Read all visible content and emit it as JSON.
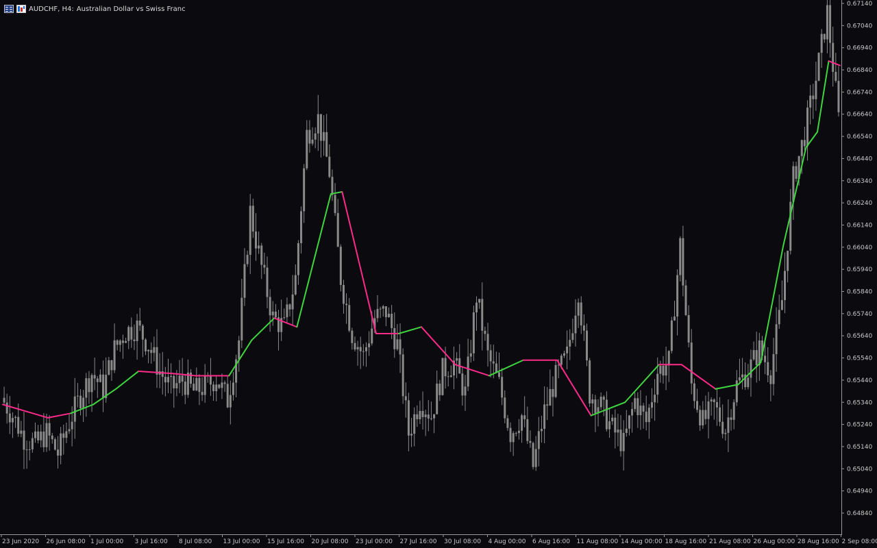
{
  "header": {
    "symbol_timeframe": "AUDCHF, H4:",
    "description": "Australian Dollar vs Swiss  Franc"
  },
  "colors": {
    "background": "#0b0b0f",
    "candle": "#8a8a8a",
    "trend_up": "#3fd63f",
    "trend_down": "#ff2a8a",
    "axis": "#9a9a9a"
  },
  "price_axis": {
    "labels": [
      "0.67140",
      "0.67040",
      "0.66940",
      "0.66840",
      "0.66740",
      "0.66640",
      "0.66540",
      "0.66440",
      "0.66340",
      "0.66240",
      "0.66140",
      "0.66040",
      "0.65940",
      "0.65840",
      "0.65740",
      "0.65640",
      "0.65540",
      "0.65440",
      "0.65340",
      "0.65240",
      "0.65140",
      "0.65040",
      "0.64940",
      "0.64840"
    ],
    "max": 0.6714,
    "min": 0.6484
  },
  "time_axis": {
    "labels": [
      "23 Jun 2020",
      "26 Jun 08:00",
      "1 Jul 00:00",
      "3 Jul 16:00",
      "8 Jul 08:00",
      "13 Jul 00:00",
      "15 Jul 16:00",
      "20 Jul 08:00",
      "23 Jul 00:00",
      "27 Jul 16:00",
      "30 Jul 08:00",
      "4 Aug 00:00",
      "6 Aug 16:00",
      "11 Aug 08:00",
      "14 Aug 00:00",
      "18 Aug 16:00",
      "21 Aug 08:00",
      "26 Aug 00:00",
      "28 Aug 16:00",
      "2 Sep 08:00"
    ]
  },
  "chart_data": {
    "type": "candlestick",
    "symbol": "AUDCHF",
    "timeframe": "H4",
    "closes": [
      0.6536,
      0.6528,
      0.6518,
      0.6515,
      0.652,
      0.6511,
      0.6525,
      0.6537,
      0.6547,
      0.654,
      0.6558,
      0.6566,
      0.6568,
      0.656,
      0.6548,
      0.654,
      0.6544,
      0.6539,
      0.6541,
      0.6545,
      0.6535,
      0.6562,
      0.662,
      0.6595,
      0.6572,
      0.6568,
      0.659,
      0.6655,
      0.6662,
      0.6638,
      0.659,
      0.6565,
      0.6555,
      0.6572,
      0.6575,
      0.656,
      0.652,
      0.6535,
      0.6528,
      0.6548,
      0.6552,
      0.6538,
      0.6582,
      0.6555,
      0.6542,
      0.652,
      0.6528,
      0.6505,
      0.653,
      0.6545,
      0.6555,
      0.6585,
      0.6538,
      0.6532,
      0.6522,
      0.6515,
      0.6535,
      0.6525,
      0.6548,
      0.6552,
      0.6605,
      0.6542,
      0.6525,
      0.6532,
      0.6522,
      0.6542,
      0.6548,
      0.6558,
      0.6548,
      0.658,
      0.6635,
      0.6655,
      0.668,
      0.671,
      0.6662
    ],
    "trend_line": [
      {
        "index": 0,
        "value": 0.6533,
        "dir": "down"
      },
      {
        "index": 2,
        "value": 0.653,
        "dir": "down"
      },
      {
        "index": 4,
        "value": 0.6527,
        "dir": "down"
      },
      {
        "index": 6,
        "value": 0.6529,
        "dir": "up"
      },
      {
        "index": 8,
        "value": 0.6533,
        "dir": "up"
      },
      {
        "index": 10,
        "value": 0.654,
        "dir": "up"
      },
      {
        "index": 12,
        "value": 0.6548,
        "dir": "down"
      },
      {
        "index": 15,
        "value": 0.6547,
        "dir": "down"
      },
      {
        "index": 17,
        "value": 0.6546,
        "dir": "down"
      },
      {
        "index": 20,
        "value": 0.6546,
        "dir": "up"
      },
      {
        "index": 22,
        "value": 0.6562,
        "dir": "up"
      },
      {
        "index": 24,
        "value": 0.6572,
        "dir": "down"
      },
      {
        "index": 26,
        "value": 0.6568,
        "dir": "up"
      },
      {
        "index": 29,
        "value": 0.6628,
        "dir": "up"
      },
      {
        "index": 30,
        "value": 0.6629,
        "dir": "down"
      },
      {
        "index": 33,
        "value": 0.6565,
        "dir": "down"
      },
      {
        "index": 35,
        "value": 0.6565,
        "dir": "up"
      },
      {
        "index": 37,
        "value": 0.6568,
        "dir": "down"
      },
      {
        "index": 40,
        "value": 0.6551,
        "dir": "down"
      },
      {
        "index": 43,
        "value": 0.6546,
        "dir": "up"
      },
      {
        "index": 46,
        "value": 0.6553,
        "dir": "down"
      },
      {
        "index": 49,
        "value": 0.6553,
        "dir": "down"
      },
      {
        "index": 52,
        "value": 0.6528,
        "dir": "up"
      },
      {
        "index": 55,
        "value": 0.6534,
        "dir": "up"
      },
      {
        "index": 58,
        "value": 0.6551,
        "dir": "down"
      },
      {
        "index": 60,
        "value": 0.6551,
        "dir": "down"
      },
      {
        "index": 63,
        "value": 0.654,
        "dir": "up"
      },
      {
        "index": 65,
        "value": 0.6542,
        "dir": "up"
      },
      {
        "index": 67,
        "value": 0.6552,
        "dir": "up"
      },
      {
        "index": 69,
        "value": 0.6605,
        "dir": "up"
      },
      {
        "index": 71,
        "value": 0.6649,
        "dir": "up"
      },
      {
        "index": 72,
        "value": 0.6656,
        "dir": "up"
      },
      {
        "index": 73,
        "value": 0.6688,
        "dir": "down"
      },
      {
        "index": 74,
        "value": 0.6686,
        "dir": "down"
      }
    ]
  }
}
